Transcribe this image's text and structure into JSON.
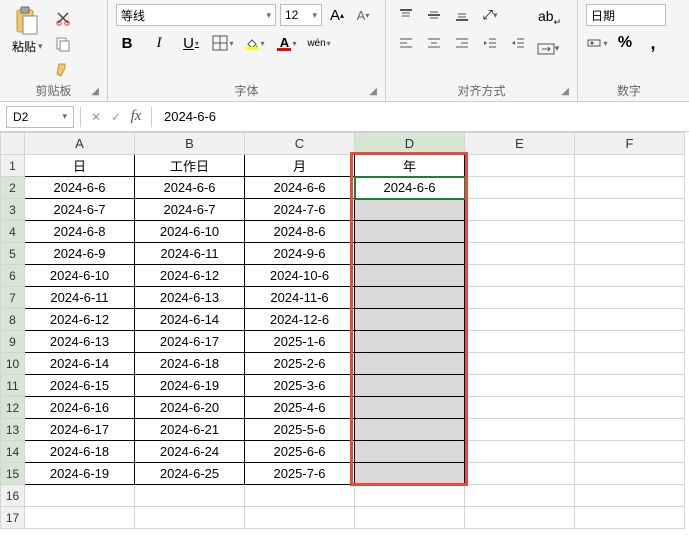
{
  "ribbon": {
    "clipboard": {
      "label": "剪贴板",
      "paste_label": "粘贴"
    },
    "font": {
      "label": "字体",
      "name": "等线",
      "size": "12",
      "bold": "B",
      "italic": "I",
      "underline": "U",
      "wen": "wén",
      "fill_color": "#ffff00",
      "font_color": "#ff0000"
    },
    "align": {
      "label": "对齐方式",
      "wrap": "ab"
    },
    "number": {
      "label": "数字",
      "format": "日期",
      "percent": "%"
    }
  },
  "formula_bar": {
    "name_box": "D2",
    "fx": "fx",
    "value": "2024-6-6"
  },
  "grid": {
    "col_headers": [
      "A",
      "B",
      "C",
      "D",
      "E",
      "F"
    ],
    "row_headers": [
      "1",
      "2",
      "3",
      "4",
      "5",
      "6",
      "7",
      "8",
      "9",
      "10",
      "11",
      "12",
      "13",
      "14",
      "15",
      "16",
      "17"
    ],
    "header_row": [
      "日",
      "工作日",
      "月",
      "年"
    ],
    "data": [
      [
        "2024-6-6",
        "2024-6-6",
        "2024-6-6",
        "2024-6-6"
      ],
      [
        "2024-6-7",
        "2024-6-7",
        "2024-7-6",
        ""
      ],
      [
        "2024-6-8",
        "2024-6-10",
        "2024-8-6",
        ""
      ],
      [
        "2024-6-9",
        "2024-6-11",
        "2024-9-6",
        ""
      ],
      [
        "2024-6-10",
        "2024-6-12",
        "2024-10-6",
        ""
      ],
      [
        "2024-6-11",
        "2024-6-13",
        "2024-11-6",
        ""
      ],
      [
        "2024-6-12",
        "2024-6-14",
        "2024-12-6",
        ""
      ],
      [
        "2024-6-13",
        "2024-6-17",
        "2025-1-6",
        ""
      ],
      [
        "2024-6-14",
        "2024-6-18",
        "2025-2-6",
        ""
      ],
      [
        "2024-6-15",
        "2024-6-19",
        "2025-3-6",
        ""
      ],
      [
        "2024-6-16",
        "2024-6-20",
        "2025-4-6",
        ""
      ],
      [
        "2024-6-17",
        "2024-6-21",
        "2025-5-6",
        ""
      ],
      [
        "2024-6-18",
        "2024-6-24",
        "2025-6-6",
        ""
      ],
      [
        "2024-6-19",
        "2024-6-25",
        "2025-7-6",
        ""
      ]
    ],
    "selected_col": "D",
    "selected_rows_start": 2,
    "selected_rows_end": 15,
    "active_cell": "D2"
  }
}
